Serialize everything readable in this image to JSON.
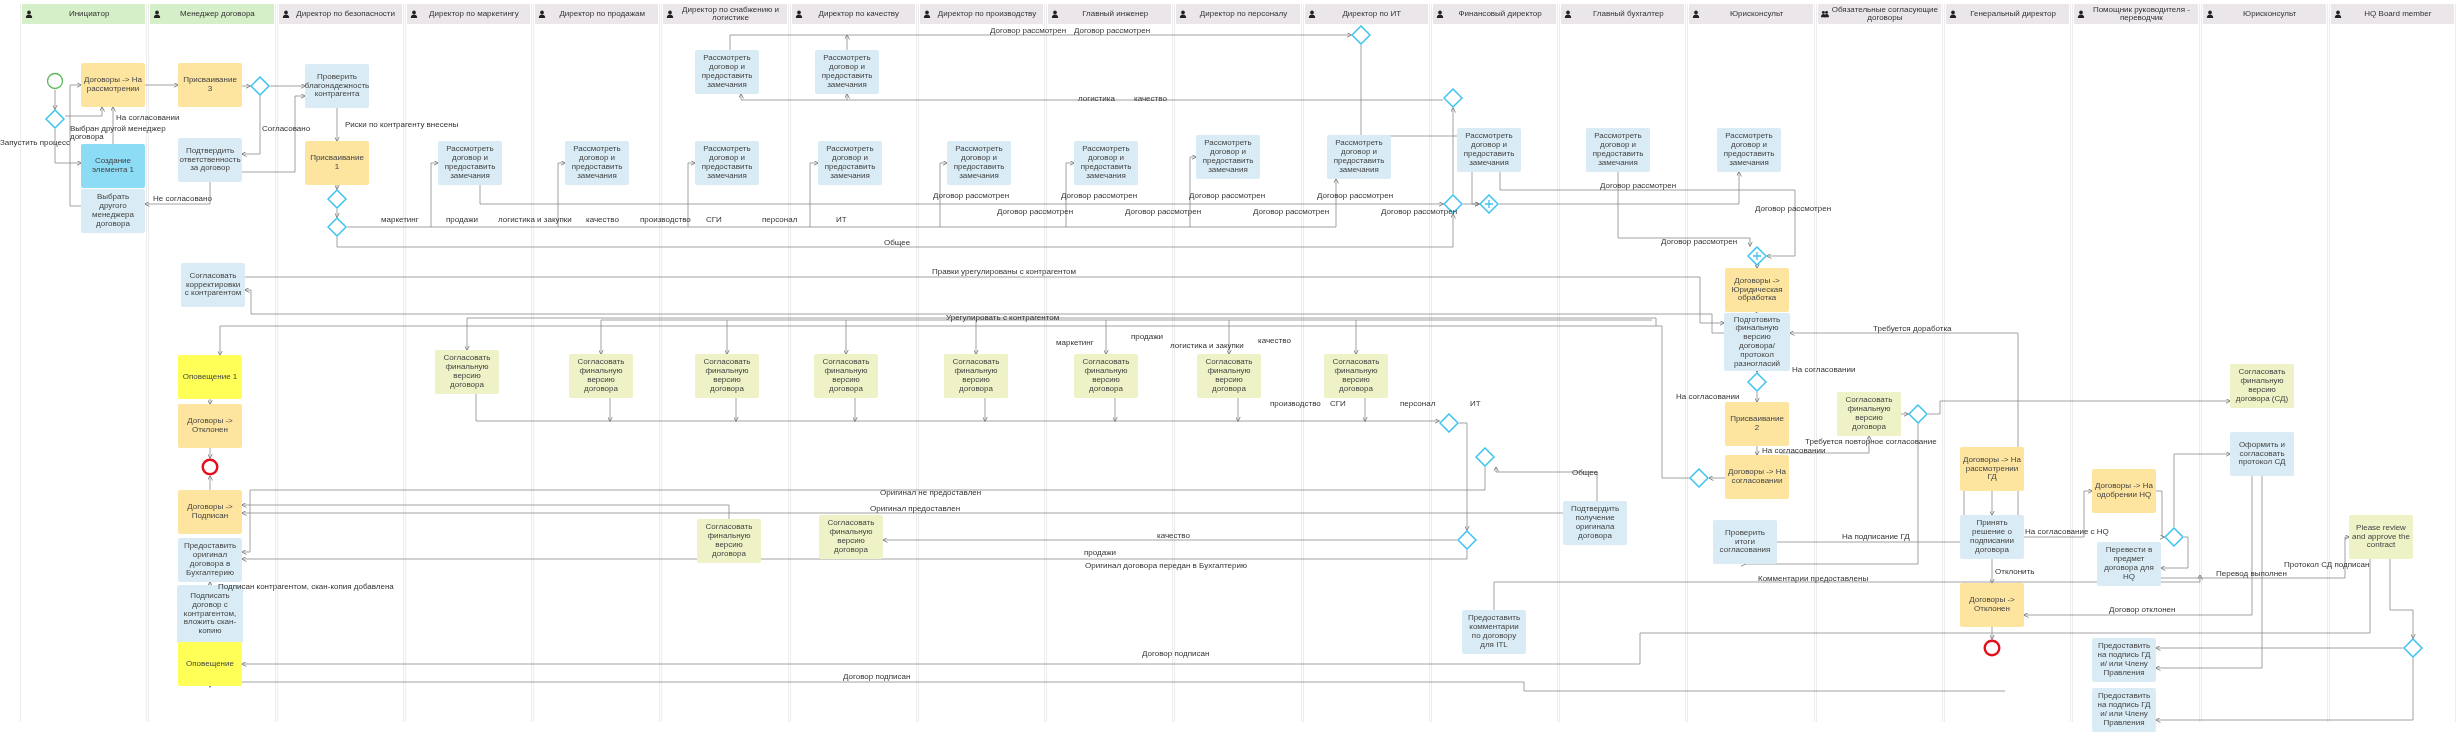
{
  "lanes": [
    {
      "title": "Инициатор",
      "kind": "person",
      "highlighted": true
    },
    {
      "title": "Менеджер договора",
      "kind": "person",
      "highlighted": true
    },
    {
      "title": "Директор по безопасности",
      "kind": "person",
      "highlighted": false
    },
    {
      "title": "Директор по маркетингу",
      "kind": "person",
      "highlighted": false
    },
    {
      "title": "Директор по продажам",
      "kind": "person",
      "highlighted": false
    },
    {
      "title": "Директор по снабжению и логистике",
      "kind": "person",
      "highlighted": false
    },
    {
      "title": "Директор по качеству",
      "kind": "person",
      "highlighted": false
    },
    {
      "title": "Директор по производству",
      "kind": "person",
      "highlighted": false
    },
    {
      "title": "Главный инженер",
      "kind": "person",
      "highlighted": false
    },
    {
      "title": "Директор по персоналу",
      "kind": "person",
      "highlighted": false
    },
    {
      "title": "Директор по ИТ",
      "kind": "person",
      "highlighted": false
    },
    {
      "title": "Финансовый директор",
      "kind": "person",
      "highlighted": false
    },
    {
      "title": "Главный бухгалтер",
      "kind": "person",
      "highlighted": false
    },
    {
      "title": "Юрисконсульт",
      "kind": "person",
      "highlighted": false
    },
    {
      "title": "Обязательные согласующие договоры",
      "kind": "group",
      "highlighted": false
    },
    {
      "title": "Генеральный директор",
      "kind": "person",
      "highlighted": false
    },
    {
      "title": "Помощник руководителя - переводчик",
      "kind": "person",
      "highlighted": false
    },
    {
      "title": "Юрисконсульт",
      "kind": "person",
      "highlighted": false
    },
    {
      "title": "HQ Board member",
      "kind": "person",
      "highlighted": false
    }
  ],
  "nodes": [
    {
      "kind": "gateway"
    },
    {
      "kind": "start"
    },
    {
      "kind": "status",
      "text": "Договоры -> На рассмотрении"
    },
    {
      "kind": "status",
      "text": "Присваивание 3"
    },
    {
      "kind": "gateway"
    },
    {
      "kind": "task",
      "text": "Проверить благонадежность контрагента"
    },
    {
      "kind": "task",
      "text": "Рассмотреть договор и предоставить замечания"
    },
    {
      "kind": "task",
      "text": "Рассмотреть договор и предоставить замечания"
    },
    {
      "kind": "gateway"
    },
    {
      "kind": "gateway"
    },
    {
      "kind": "active",
      "text": "Создание элемента 1"
    },
    {
      "kind": "task",
      "text": "Подтвердить ответственность за договор"
    },
    {
      "kind": "status",
      "text": "Присваивание 1"
    },
    {
      "kind": "task",
      "text": "Рассмотреть договор и предоставить замечания"
    },
    {
      "kind": "task",
      "text": "Рассмотреть договор и предоставить замечания"
    },
    {
      "kind": "task",
      "text": "Рассмотреть договор и предоставить замечания"
    },
    {
      "kind": "task",
      "text": "Рассмотреть договор и предоставить замечания"
    },
    {
      "kind": "task",
      "text": "Рассмотреть договор и предоставить замечания"
    },
    {
      "kind": "task",
      "text": "Рассмотреть договор и предоставить замечания"
    },
    {
      "kind": "task",
      "text": "Рассмотреть договор и предоставить замечания"
    },
    {
      "kind": "task",
      "text": "Рассмотреть договор и предоставить замечания"
    },
    {
      "kind": "task",
      "text": "Рассмотреть договор и предоставить замечания"
    },
    {
      "kind": "task",
      "text": "Рассмотреть договор и предоставить замечания"
    },
    {
      "kind": "task",
      "text": "Рассмотреть договор и предоставить замечания"
    },
    {
      "kind": "task",
      "text": "Выбрать другого менеджера договора"
    },
    {
      "kind": "gateway"
    },
    {
      "kind": "gateway"
    },
    {
      "kind": "parallel"
    },
    {
      "kind": "gateway"
    },
    {
      "kind": "parallel"
    },
    {
      "kind": "task",
      "text": "Согласовать корректировки с контрагентом"
    },
    {
      "kind": "status",
      "text": "Договоры -> Юридическая обработка"
    },
    {
      "kind": "task",
      "text": "Подготовить финальную версию договора/ протокол разногласий"
    },
    {
      "kind": "notify",
      "text": "Оповещение 1"
    },
    {
      "kind": "approve",
      "text": "Согласовать финальную версию договора"
    },
    {
      "kind": "approve",
      "text": "Согласовать финальную версию договора"
    },
    {
      "kind": "approve",
      "text": "Согласовать финальную версию договора"
    },
    {
      "kind": "approve",
      "text": "Согласовать финальную версию договора"
    },
    {
      "kind": "approve",
      "text": "Согласовать финальную версию договора"
    },
    {
      "kind": "approve",
      "text": "Согласовать финальную версию договора"
    },
    {
      "kind": "approve",
      "text": "Согласовать финальную версию договора"
    },
    {
      "kind": "approve",
      "text": "Согласовать финальную версию договора"
    },
    {
      "kind": "gateway"
    },
    {
      "kind": "approve",
      "text": "Согласовать финальную версию договора (СД)"
    },
    {
      "kind": "status",
      "text": "Договоры -> Отклонен"
    },
    {
      "kind": "gateway"
    },
    {
      "kind": "status",
      "text": "Присваивание 2"
    },
    {
      "kind": "approve",
      "text": "Согласовать финальную версию договора"
    },
    {
      "kind": "gateway"
    },
    {
      "kind": "end"
    },
    {
      "kind": "gateway"
    },
    {
      "kind": "gateway"
    },
    {
      "kind": "status",
      "text": "Договоры -> На согласовании"
    },
    {
      "kind": "status",
      "text": "Договоры -> На рассмотрении ГД"
    },
    {
      "kind": "task",
      "text": "Оформить и согласовать протокол СД"
    },
    {
      "kind": "status",
      "text": "Договоры -> На одобрении HQ"
    },
    {
      "kind": "status",
      "text": "Договоры -> Подписан"
    },
    {
      "kind": "approve",
      "text": "Согласовать финальную версию договора"
    },
    {
      "kind": "approve",
      "text": "Согласовать финальную версию договора"
    },
    {
      "kind": "gateway"
    },
    {
      "kind": "task",
      "text": "Подтвердить получение оригинала договора"
    },
    {
      "kind": "task",
      "text": "Проверить итоги согласования"
    },
    {
      "kind": "task",
      "text": "Принять решение о подписании договора"
    },
    {
      "kind": "gateway"
    },
    {
      "kind": "approve",
      "text": "Please review and approve the contract"
    },
    {
      "kind": "task",
      "text": "Предоставить оригинал договора в Бухгалтерию"
    },
    {
      "kind": "task",
      "text": "Перевести в предмет договора для HQ"
    },
    {
      "kind": "task",
      "text": "Подписать договор с контрагентом, вложить скан-копию"
    },
    {
      "kind": "status",
      "text": "Договоры -> Отклонен"
    },
    {
      "kind": "notify",
      "text": "Оповещение"
    },
    {
      "kind": "task",
      "text": "Предоставить комментарии по договору для ITL"
    },
    {
      "kind": "end"
    },
    {
      "kind": "task",
      "text": "Предоставить на подпись ГД и/ или Члену Правления"
    },
    {
      "kind": "gateway"
    },
    {
      "kind": "task",
      "text": "Предоставить на подпись ГД и/ или Члену Правления"
    }
  ],
  "labels": [
    "Запустить процесс",
    "На согласовании",
    "Выбран другой менеджер договора",
    "Не согласовано",
    "Согласовано",
    "Риски по контрагенту внесены",
    "маркетинг",
    "продажи",
    "логистика и закупки",
    "качество",
    "производство",
    "СГИ",
    "персонал",
    "ИТ",
    "Общее",
    "Договор рассмотрен",
    "Договор рассмотрен",
    "логистика",
    "качество",
    "Договор рассмотрен",
    "Договор рассмотрен",
    "Договор рассмотрен",
    "Договор рассмотрен",
    "Договор рассмотрен",
    "Договор рассмотрен",
    "Договор рассмотрен",
    "Договор рассмотрен",
    "Договор рассмотрен",
    "Договор рассмотрен",
    "Договор рассмотрен",
    "Правки урегулированы с контрагентом",
    "Урегулировать с контрагентом",
    "маркетинг",
    "продажи",
    "логистика и закупки",
    "качество",
    "производство",
    "СГИ",
    "персонал",
    "ИТ",
    "Общее",
    "Оригинал не предоставлен",
    "Оригинал предоставлен",
    "качество",
    "продажи",
    "Оригинал договора передан в Бухгалтерию",
    "Договор подписан",
    "Договор подписан",
    "Подписан контрагентом, скан-копия добавлена",
    "Требуется доработка",
    "На согласовании",
    "На согласовании",
    "Требуется повторное согласование",
    "На согласовании",
    "На подписание ГД",
    "На согласование с HQ",
    "Отклонить",
    "Комментарии предоставлены",
    "Договор отклонен",
    "Перевод выполнен",
    "Протокол СД подписан"
  ]
}
